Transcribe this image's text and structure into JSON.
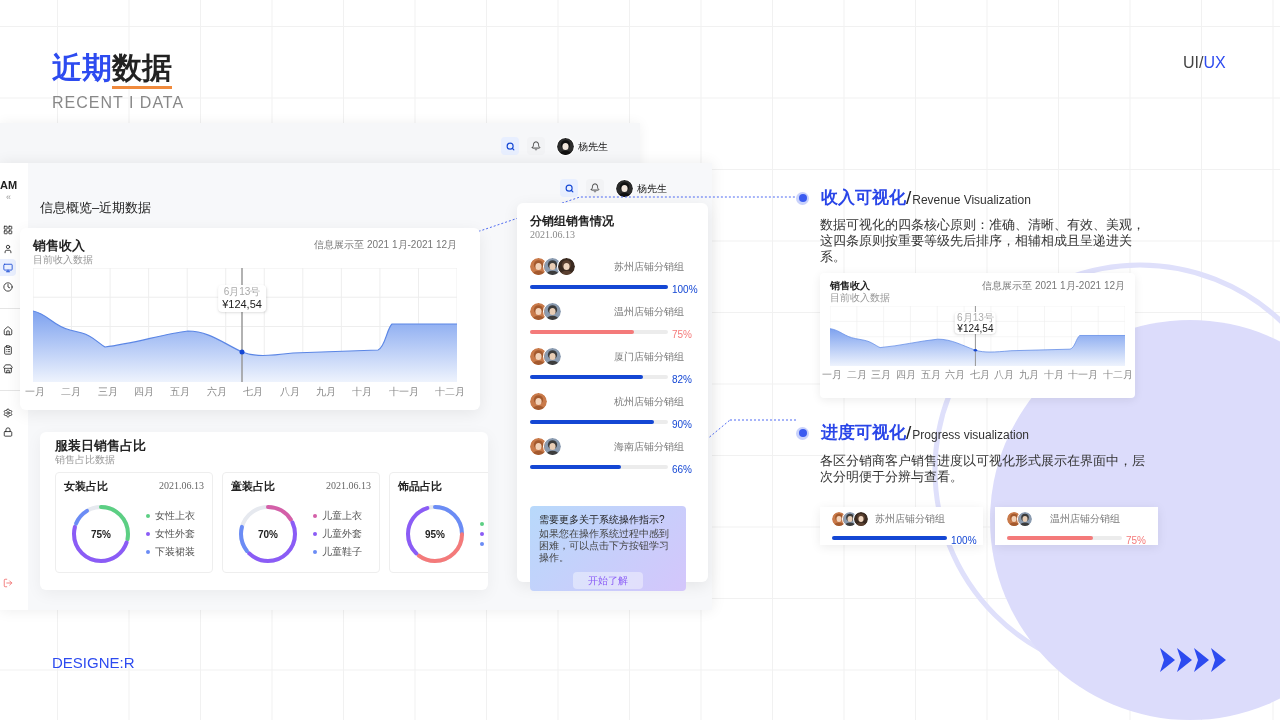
{
  "heading": {
    "accent": "近期",
    "text": "数据",
    "subtitle": "RECENT I DATA"
  },
  "tag": {
    "left": "UI",
    "separator": "/",
    "right": "UX"
  },
  "back_window": {
    "user_name": "杨先生"
  },
  "main_window": {
    "brand": "AM",
    "collapse": "«",
    "nav": [
      {
        "selected": false
      },
      {
        "selected": false
      },
      {
        "selected": true
      },
      {
        "selected": false
      },
      {
        "selected": false
      },
      {
        "selected": false
      },
      {
        "selected": false
      },
      {
        "selected": false
      },
      {
        "selected": false
      }
    ],
    "user_name": "杨先生",
    "page_title": "信息概览–近期数据",
    "revenue": {
      "title": "销售收入",
      "subtitle": "目前收入数据",
      "range": "信息展示至 2021 1月-2021 12月",
      "tooltip_date": "6月13号",
      "tooltip_value": "¥124,54",
      "months": [
        "一月",
        "二月",
        "三月",
        "四月",
        "五月",
        "六月",
        "七月",
        "八月",
        "九月",
        "十月",
        "十一月",
        "十二月"
      ]
    },
    "share": {
      "title": "服装日销售占比",
      "subtitle": "销售占比数据",
      "donuts": [
        {
          "title": "女装占比",
          "date": "2021.06.13",
          "value": "75%",
          "legend": [
            {
              "label": "女性上衣",
              "color": "#5ccf83"
            },
            {
              "label": "女性外套",
              "color": "#8b5cf6"
            },
            {
              "label": "下装裙装",
              "color": "#6b8cf5"
            }
          ]
        },
        {
          "title": "童装占比",
          "date": "2021.06.13",
          "value": "70%",
          "legend": [
            {
              "label": "儿童上衣",
              "color": "#d45fa8"
            },
            {
              "label": "儿童外套",
              "color": "#8b5cf6"
            },
            {
              "label": "儿童鞋子",
              "color": "#6b8cf5"
            }
          ]
        },
        {
          "title": "饰品占比",
          "value": "95%",
          "legend": [
            {
              "color": "#5ccf83"
            },
            {
              "color": "#8b5cf6"
            },
            {
              "color": "#6b8cf5"
            }
          ]
        }
      ]
    },
    "groups": {
      "title": "分销组销售情况",
      "date": "2021.06.13",
      "rows": [
        {
          "name": "苏州店铺分销组",
          "level": 1,
          "percent": "100%",
          "color": "#1447d4",
          "avatars": [
            {
              "kind": "picture"
            },
            {
              "kind": "picture"
            },
            {
              "kind": "picture"
            }
          ]
        },
        {
          "name": "温州店铺分销组",
          "level": 0.75,
          "percent": "75%",
          "color": "#f47a7a",
          "avatars": [
            {
              "kind": "picture"
            },
            {
              "kind": "picture"
            }
          ]
        },
        {
          "name": "厦门店铺分销组",
          "level": 0.82,
          "percent": "82%",
          "color": "#1447d4",
          "avatars": [
            {
              "kind": "picture"
            },
            {
              "kind": "picture"
            }
          ]
        },
        {
          "name": "杭州店铺分销组",
          "level": 0.9,
          "percent": "90%",
          "color": "#1447d4",
          "avatars": [
            {
              "kind": "picture"
            }
          ]
        },
        {
          "name": "海南店铺分销组",
          "level": 0.66,
          "percent": "66%",
          "color": "#1447d4",
          "avatars": [
            {
              "kind": "picture"
            },
            {
              "kind": "picture"
            }
          ]
        }
      ]
    },
    "help": {
      "title": "需要更多关于系统操作指示?",
      "text": "如果您在操作系统过程中感到困难，可以点击下方按钮学习操作。",
      "button": "开始了解"
    }
  },
  "callouts": [
    {
      "title": "收入可视化",
      "separator": "/",
      "title_en": "Revenue Visualization",
      "text": "数据可视化的四条核心原则：准确、清晰、有效、美观，这四条原则按重要等级先后排序，相辅相成且呈递进关系。"
    },
    {
      "title": "进度可视化",
      "separator": "/",
      "title_en": "Progress visualization",
      "text": "各区分销商客户销售进度以可视化形式展示在界面中，层次分明便于分辨与查看。"
    }
  ],
  "preview_revenue": {
    "title": "销售收入",
    "subtitle": "目前收入数据",
    "range": "信息展示至 2021 1月-2021 12月",
    "tooltip_date": "6月13号",
    "tooltip_value": "¥124,54",
    "months": [
      "一月",
      "二月",
      "三月",
      "四月",
      "五月",
      "六月",
      "七月",
      "八月",
      "九月",
      "十月",
      "十一月",
      "十二月"
    ]
  },
  "preview_groups": [
    {
      "name": "苏州店铺分销组",
      "level": 1,
      "percent": "100%",
      "color": "#1447d4",
      "avatars": [
        {
          "kind": "picture"
        },
        {
          "kind": "picture"
        },
        {
          "kind": "picture"
        }
      ]
    },
    {
      "name": "温州店铺分销组",
      "level": 0.75,
      "percent": "75%",
      "color": "#f47a7a",
      "avatars": [
        {
          "kind": "picture"
        },
        {
          "kind": "picture"
        }
      ]
    }
  ],
  "footer": {
    "signature": "DESIGNE:R"
  }
}
